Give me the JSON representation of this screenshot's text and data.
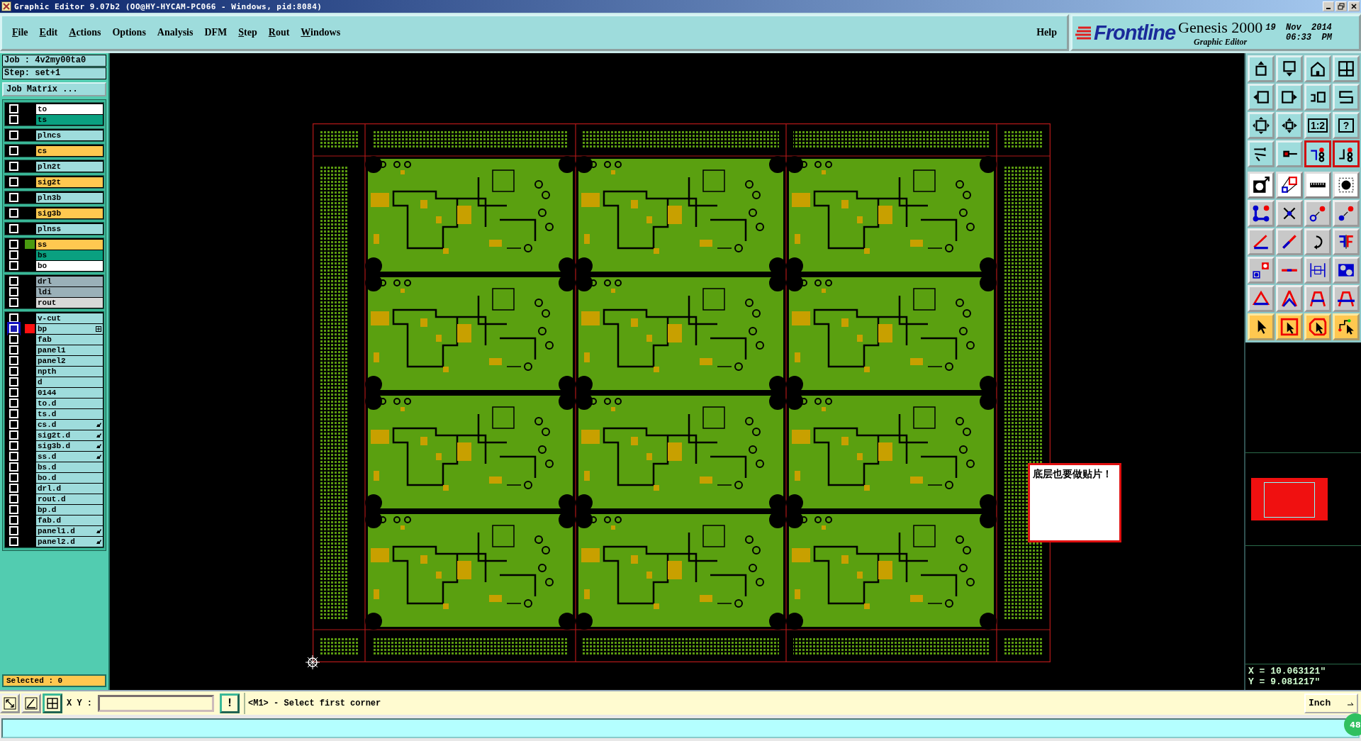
{
  "window": {
    "title": "Graphic Editor 9.07b2 (OO@HY-HYCAM-PC066 - Windows, pid:8084)"
  },
  "menu": [
    {
      "label": "File",
      "underlined": true
    },
    {
      "label": "Edit",
      "underlined": true
    },
    {
      "label": "Actions",
      "underlined": true
    },
    {
      "label": "Options",
      "underlined": false
    },
    {
      "label": "Analysis",
      "underlined": false
    },
    {
      "label": "DFM",
      "underlined": false
    },
    {
      "label": "Step",
      "underlined": true
    },
    {
      "label": "Rout",
      "underlined": true
    },
    {
      "label": "Windows",
      "underlined": true
    }
  ],
  "help": "Help",
  "brand": {
    "logo": "Frontline",
    "product": "Genesis 2000",
    "subtitle": "Graphic Editor",
    "date": "19  Nov  2014",
    "time": "06:33  PM"
  },
  "job": {
    "job": "Job : 4v2my00ta0",
    "step": "Step: set+1",
    "matrix_button": "Job Matrix ..."
  },
  "layer_groups": [
    {
      "layers": [
        {
          "name": "to",
          "color": "#ffffff",
          "selected": false
        },
        {
          "name": "ts",
          "color": "#0aa080",
          "selected": false
        }
      ]
    },
    {
      "layers": [
        {
          "name": "plncs",
          "color": "#9edcdc",
          "selected": false
        }
      ]
    },
    {
      "layers": [
        {
          "name": "cs",
          "color": "#ffc850",
          "selected": false
        }
      ]
    },
    {
      "layers": [
        {
          "name": "pln2t",
          "color": "#9edcdc",
          "selected": false
        }
      ]
    },
    {
      "layers": [
        {
          "name": "sig2t",
          "color": "#ffc850",
          "selected": false
        }
      ]
    },
    {
      "layers": [
        {
          "name": "pln3b",
          "color": "#9edcdc",
          "selected": false
        }
      ]
    },
    {
      "layers": [
        {
          "name": "sig3b",
          "color": "#ffc850",
          "selected": false
        }
      ]
    },
    {
      "layers": [
        {
          "name": "plnss",
          "color": "#9edcdc",
          "selected": false
        }
      ]
    },
    {
      "layers": [
        {
          "name": "ss",
          "color": "#ffc850",
          "swatch": {
            "color": "#4a9a10"
          },
          "selected": false
        },
        {
          "name": "bs",
          "color": "#0aa080",
          "selected": false
        },
        {
          "name": "bo",
          "color": "#ffffff",
          "selected": false
        }
      ]
    },
    {
      "layers": [
        {
          "name": "drl",
          "color": "#9ab0b8",
          "selected": false
        },
        {
          "name": "ldi",
          "color": "#9ab0b8",
          "selected": false
        },
        {
          "name": "rout",
          "color": "#d8d8d8",
          "selected": false
        }
      ]
    },
    {
      "layers": [
        {
          "name": "v-cut",
          "color": "#9edcdc",
          "selected": false
        },
        {
          "name": "bp",
          "color": "#9edcdc",
          "swatch": {
            "color": "#ff1010"
          },
          "selected": true,
          "kind": "plus"
        },
        {
          "name": "fab",
          "color": "#9edcdc",
          "selected": false
        },
        {
          "name": "panel1",
          "color": "#9edcdc",
          "selected": false
        },
        {
          "name": "panel2",
          "color": "#9edcdc",
          "selected": false
        },
        {
          "name": "npth",
          "color": "#9edcdc",
          "selected": false
        },
        {
          "name": "d",
          "color": "#9edcdc",
          "selected": false
        },
        {
          "name": "0144",
          "color": "#9edcdc",
          "selected": false
        },
        {
          "name": "to.d",
          "color": "#9edcdc",
          "selected": false
        },
        {
          "name": "ts.d",
          "color": "#9edcdc",
          "selected": false
        },
        {
          "name": "cs.d",
          "color": "#9edcdc",
          "selected": false,
          "kind": "hand"
        },
        {
          "name": "sig2t.d",
          "color": "#9edcdc",
          "selected": false,
          "kind": "hand"
        },
        {
          "name": "sig3b.d",
          "color": "#9edcdc",
          "selected": false,
          "kind": "hand"
        },
        {
          "name": "ss.d",
          "color": "#9edcdc",
          "selected": false,
          "kind": "hand"
        },
        {
          "name": "bs.d",
          "color": "#9edcdc",
          "selected": false
        },
        {
          "name": "bo.d",
          "color": "#9edcdc",
          "selected": false
        },
        {
          "name": "drl.d",
          "color": "#9edcdc",
          "selected": false
        },
        {
          "name": "rout.d",
          "color": "#9edcdc",
          "selected": false
        },
        {
          "name": "bp.d",
          "color": "#9edcdc",
          "selected": false
        },
        {
          "name": "fab.d",
          "color": "#9edcdc",
          "selected": false
        },
        {
          "name": "panel1.d",
          "color": "#9edcdc",
          "selected": false,
          "kind": "hand"
        },
        {
          "name": "panel2.d",
          "color": "#9edcdc",
          "selected": false,
          "kind": "hand"
        }
      ]
    }
  ],
  "selected_count": "Selected : 0",
  "note": "底层也要做贴片！",
  "toolbar": {
    "ratio_button": "1:2",
    "help_button": "?"
  },
  "coordinates": {
    "x": "X = 10.063121\"",
    "y": "Y = 9.081217\""
  },
  "command_bar": {
    "xy_label": "X Y :",
    "alert_button": "!",
    "message": "<M1> - Select first corner",
    "units": "Inch"
  },
  "badge": "48"
}
